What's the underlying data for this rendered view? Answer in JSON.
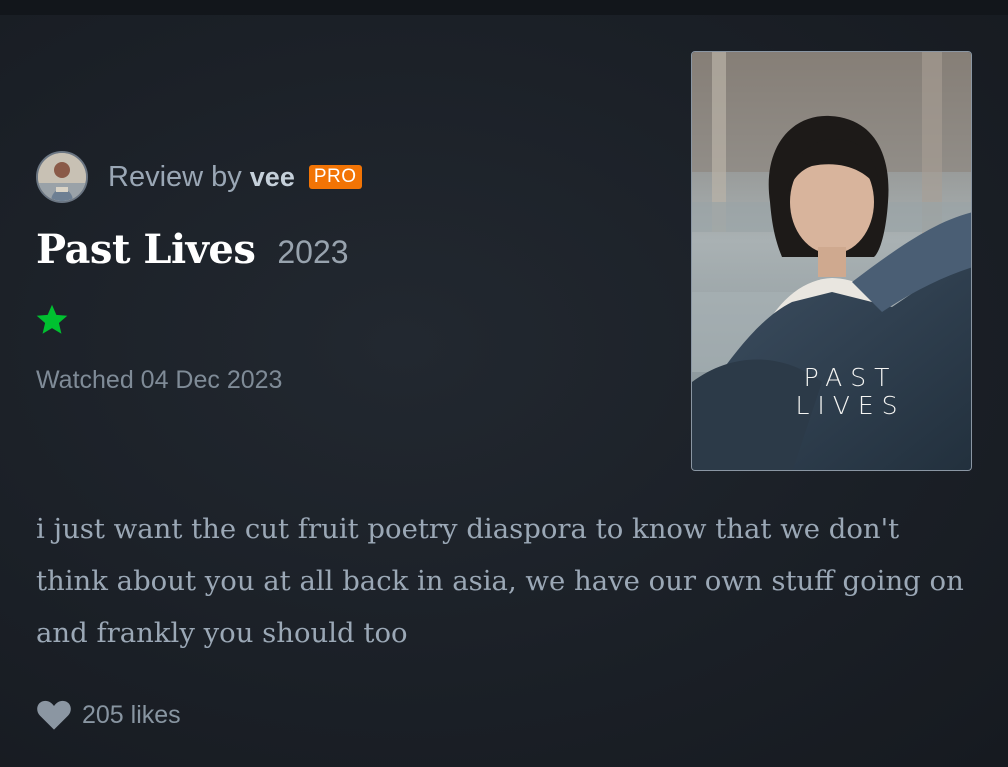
{
  "review": {
    "prefix": "Review by",
    "username": "vee",
    "badge": "PRO"
  },
  "film": {
    "title": "Past Lives",
    "year": "2023",
    "rating_stars": 1,
    "watched": "Watched 04 Dec 2023",
    "poster_title": "PAST\nLIVES"
  },
  "body": "i just want the cut fruit poetry diaspora to know that we don't think about you at all back in asia, we have our own stuff going on and frankly you should too",
  "likes": {
    "label": "205 likes",
    "icon": "heart-icon"
  },
  "colors": {
    "background": "#1b2027",
    "star": "#00c030",
    "pro_badge": "#f27405",
    "body_text": "#9ba8b6"
  }
}
